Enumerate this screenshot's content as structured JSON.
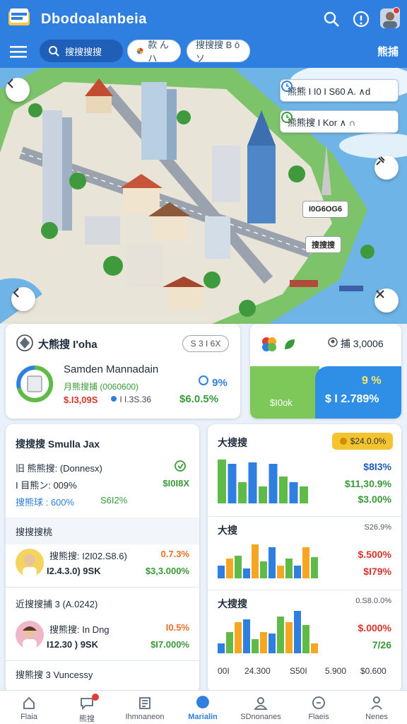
{
  "header": {
    "app_title": "Dbodoalanbeia",
    "icons": [
      "search-icon",
      "help-icon",
      "avatar",
      "notification-dot"
    ]
  },
  "nav": {
    "menu_icon": "menu-icon",
    "search_label": "搜搜搜搜",
    "chip1_label": "款 ん ハ",
    "chip2_label": "搜搜搜 B ō ソ",
    "right_label": "熊捕"
  },
  "map": {
    "tag1": "熊熊 I I0  I S60 A. ∧d",
    "tag2": "熊熊搜  I Kor   ∧ ∩",
    "label1": "I0G6OG6",
    "label2": "搜搜搜"
  },
  "manager_card": {
    "title": "大熊搜 I'oha",
    "badge": "S 3 I 6X",
    "name": "Samden Mannadain",
    "subtitle": "月熊搜捕 (0060600)",
    "value_a": "$.I3,09S",
    "value_b": "I I.3S.36",
    "pct": "9%",
    "amount": "$6.0.5%"
  },
  "stat_card": {
    "value": "捕  3,0006",
    "green_label": "$I0ok",
    "blue_p1": "9 %",
    "blue_p2": "$  I 2.789%"
  },
  "list_card": {
    "title": "搜搜搜 Smulla Jax",
    "row1": "旧 熊熊搜: (Donnesx)",
    "row2": "I 目熊ン: 009%",
    "row2_right": "$I0I8X",
    "row3": "搜熊球 :  600%",
    "row3_mid": "S6I2%",
    "band": "搜搜搜桃",
    "p1_line1": "搜熊搜: I2I02.S8.6)",
    "p1_line2": "I2.4.3.0) 9SK",
    "p1_r1": "0.7.3%",
    "p1_r2": "$3,3.000%",
    "sec2": "近搜搜捕 3 (A.0242)",
    "p2_line1": "搜熊搜: In Dng",
    "p2_line2": "I12.30 ) 9SK",
    "p2_r1": "I0.5%",
    "p2_r2": "$I7.000%",
    "sec3": "搜熊搜 3 Vuncessy"
  },
  "chart_card": {
    "title1": "大搜搜",
    "pill": "$24.0.0%",
    "r1a": "$8I3%",
    "r1b": "$11,30.9%",
    "r1c": "$3.00%",
    "title2": "大搜",
    "small2": "S26.9%",
    "r2a": "$.500%",
    "r2b": "$I79%",
    "title3": "大搜搜",
    "small3": "0.S8.0.0%",
    "r3a": "$.000%",
    "r3b": "7/26",
    "foot": [
      "00I",
      "24.300",
      "S50I",
      "5.900",
      "$0.600"
    ]
  },
  "chart_data": [
    {
      "type": "bar",
      "series": [
        {
          "values": [
            62,
            56,
            30,
            58,
            24,
            56,
            38,
            30,
            24
          ]
        }
      ],
      "colors": [
        "#5fba47",
        "#2f7fe0"
      ]
    },
    {
      "type": "bar",
      "series": [
        {
          "values": [
            18,
            28,
            32,
            14,
            48,
            24,
            44,
            18,
            28,
            18,
            44,
            30
          ]
        }
      ],
      "colors": [
        "#2f7fe0",
        "#f5a623",
        "#5fba47"
      ]
    },
    {
      "type": "bar",
      "series": [
        {
          "values": [
            14,
            30,
            44,
            48,
            20,
            30,
            28,
            52,
            44,
            60,
            40,
            14
          ]
        }
      ],
      "colors": [
        "#2f7fe0",
        "#5fba47",
        "#f5a623"
      ]
    }
  ],
  "bottom_nav": [
    {
      "label": "Flaia",
      "icon": "home-icon"
    },
    {
      "label": "熊搜",
      "icon": "chat-icon"
    },
    {
      "label": "Ihmnaneon",
      "icon": "list-icon"
    },
    {
      "label": "Marialin",
      "icon": "map-icon"
    },
    {
      "label": "SDnonanes",
      "icon": "person-icon"
    },
    {
      "label": "Flaeis",
      "icon": "finance-icon"
    },
    {
      "label": "Nenes",
      "icon": "profile-icon"
    }
  ]
}
